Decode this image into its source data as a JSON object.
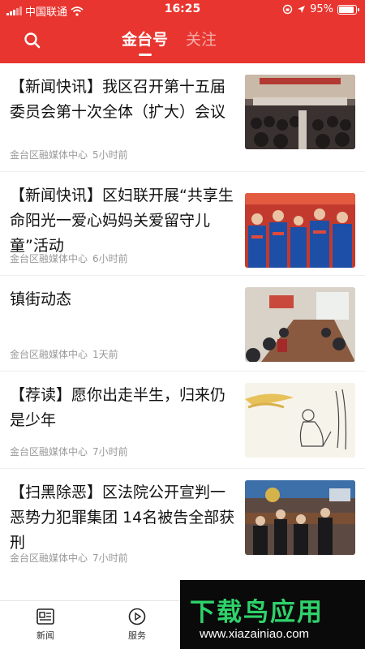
{
  "status_bar": {
    "carrier": "中国联通",
    "time": "16:25",
    "battery": "95%",
    "battery_level": 0.95
  },
  "header": {
    "tabs": [
      {
        "label": "金台号",
        "active": true
      },
      {
        "label": "关注",
        "active": false
      }
    ]
  },
  "feed": [
    {
      "title": "【新闻快讯】我区召开第十五届委员会第十次全体（扩大）会议",
      "source": "金台区融媒体中心",
      "time": "5小时前"
    },
    {
      "title": "【新闻快讯】区妇联开展“共享生命阳光一爱心妈妈关爱留守儿童”活动",
      "source": "金台区融媒体中心",
      "time": "6小时前"
    },
    {
      "title": "镇街动态",
      "source": "金台区融媒体中心",
      "time": "1天前"
    },
    {
      "title": "【荐读】愿你出走半生，归来仍是少年",
      "source": "金台区融媒体中心",
      "time": "7小时前"
    },
    {
      "title": "【扫黑除恶】区法院公开宣判一恶势力犯罪集团 14名被告全部获刑",
      "source": "金台区融媒体中心",
      "time": "7小时前"
    }
  ],
  "bottom_nav": [
    {
      "label": "新闻",
      "icon": "news-icon"
    },
    {
      "label": "服务",
      "icon": "play-circle-icon"
    }
  ],
  "watermark": {
    "title": "下载鸟应用",
    "url": "www.xiazainiao.com"
  },
  "colors": {
    "brand_red": "#e8352f",
    "watermark_green": "#2fd26a"
  }
}
